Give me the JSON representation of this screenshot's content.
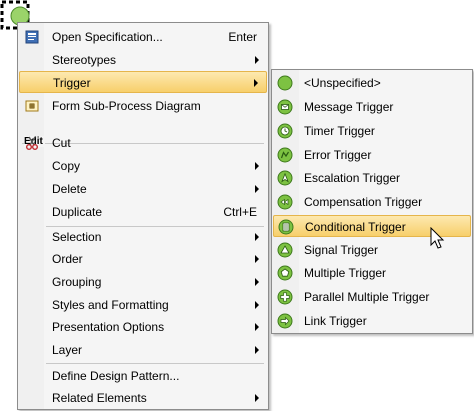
{
  "colors": {
    "highlight_top": "#fde9b0",
    "highlight_bottom": "#f7cf6b",
    "trigger_green": "#7dc242",
    "menu_bg": "#f5f5f5"
  },
  "main_menu": {
    "items": [
      {
        "label": "Open Specification...",
        "shortcut": "Enter",
        "icon": "specification-icon"
      },
      {
        "label": "Stereotypes",
        "submenu": true
      },
      {
        "label": "Trigger",
        "submenu": true,
        "highlighted": true
      },
      {
        "label": "Form Sub-Process Diagram",
        "icon": "subprocess-diagram-icon"
      }
    ],
    "edit_group": {
      "title": "Edit",
      "items": [
        {
          "label": "Cut",
          "icon": "scissors-icon"
        },
        {
          "label": "Copy",
          "submenu": true
        },
        {
          "label": "Delete",
          "submenu": true
        },
        {
          "label": "Duplicate",
          "shortcut": "Ctrl+E"
        }
      ]
    },
    "view_group": [
      {
        "label": "Selection",
        "submenu": true
      },
      {
        "label": "Order",
        "submenu": true
      },
      {
        "label": "Grouping",
        "submenu": true
      },
      {
        "label": "Styles and Formatting",
        "submenu": true
      },
      {
        "label": "Presentation Options",
        "submenu": true
      },
      {
        "label": "Layer",
        "submenu": true
      }
    ],
    "bottom_group": [
      {
        "label": "Define Design Pattern..."
      },
      {
        "label": "Related Elements",
        "submenu": true
      }
    ]
  },
  "trigger_submenu": {
    "items": [
      {
        "label": "<Unspecified>",
        "icon": "unspecified-trigger-icon"
      },
      {
        "label": "Message Trigger",
        "icon": "message-trigger-icon"
      },
      {
        "label": "Timer Trigger",
        "icon": "timer-trigger-icon"
      },
      {
        "label": "Error Trigger",
        "icon": "error-trigger-icon"
      },
      {
        "label": "Escalation Trigger",
        "icon": "escalation-trigger-icon"
      },
      {
        "label": "Compensation Trigger",
        "icon": "compensation-trigger-icon"
      },
      {
        "label": "Conditional Trigger",
        "icon": "conditional-trigger-icon",
        "highlighted": true
      },
      {
        "label": "Signal Trigger",
        "icon": "signal-trigger-icon"
      },
      {
        "label": "Multiple Trigger",
        "icon": "multiple-trigger-icon"
      },
      {
        "label": "Parallel Multiple Trigger",
        "icon": "parallel-multiple-trigger-icon"
      },
      {
        "label": "Link Trigger",
        "icon": "link-trigger-icon"
      }
    ]
  }
}
